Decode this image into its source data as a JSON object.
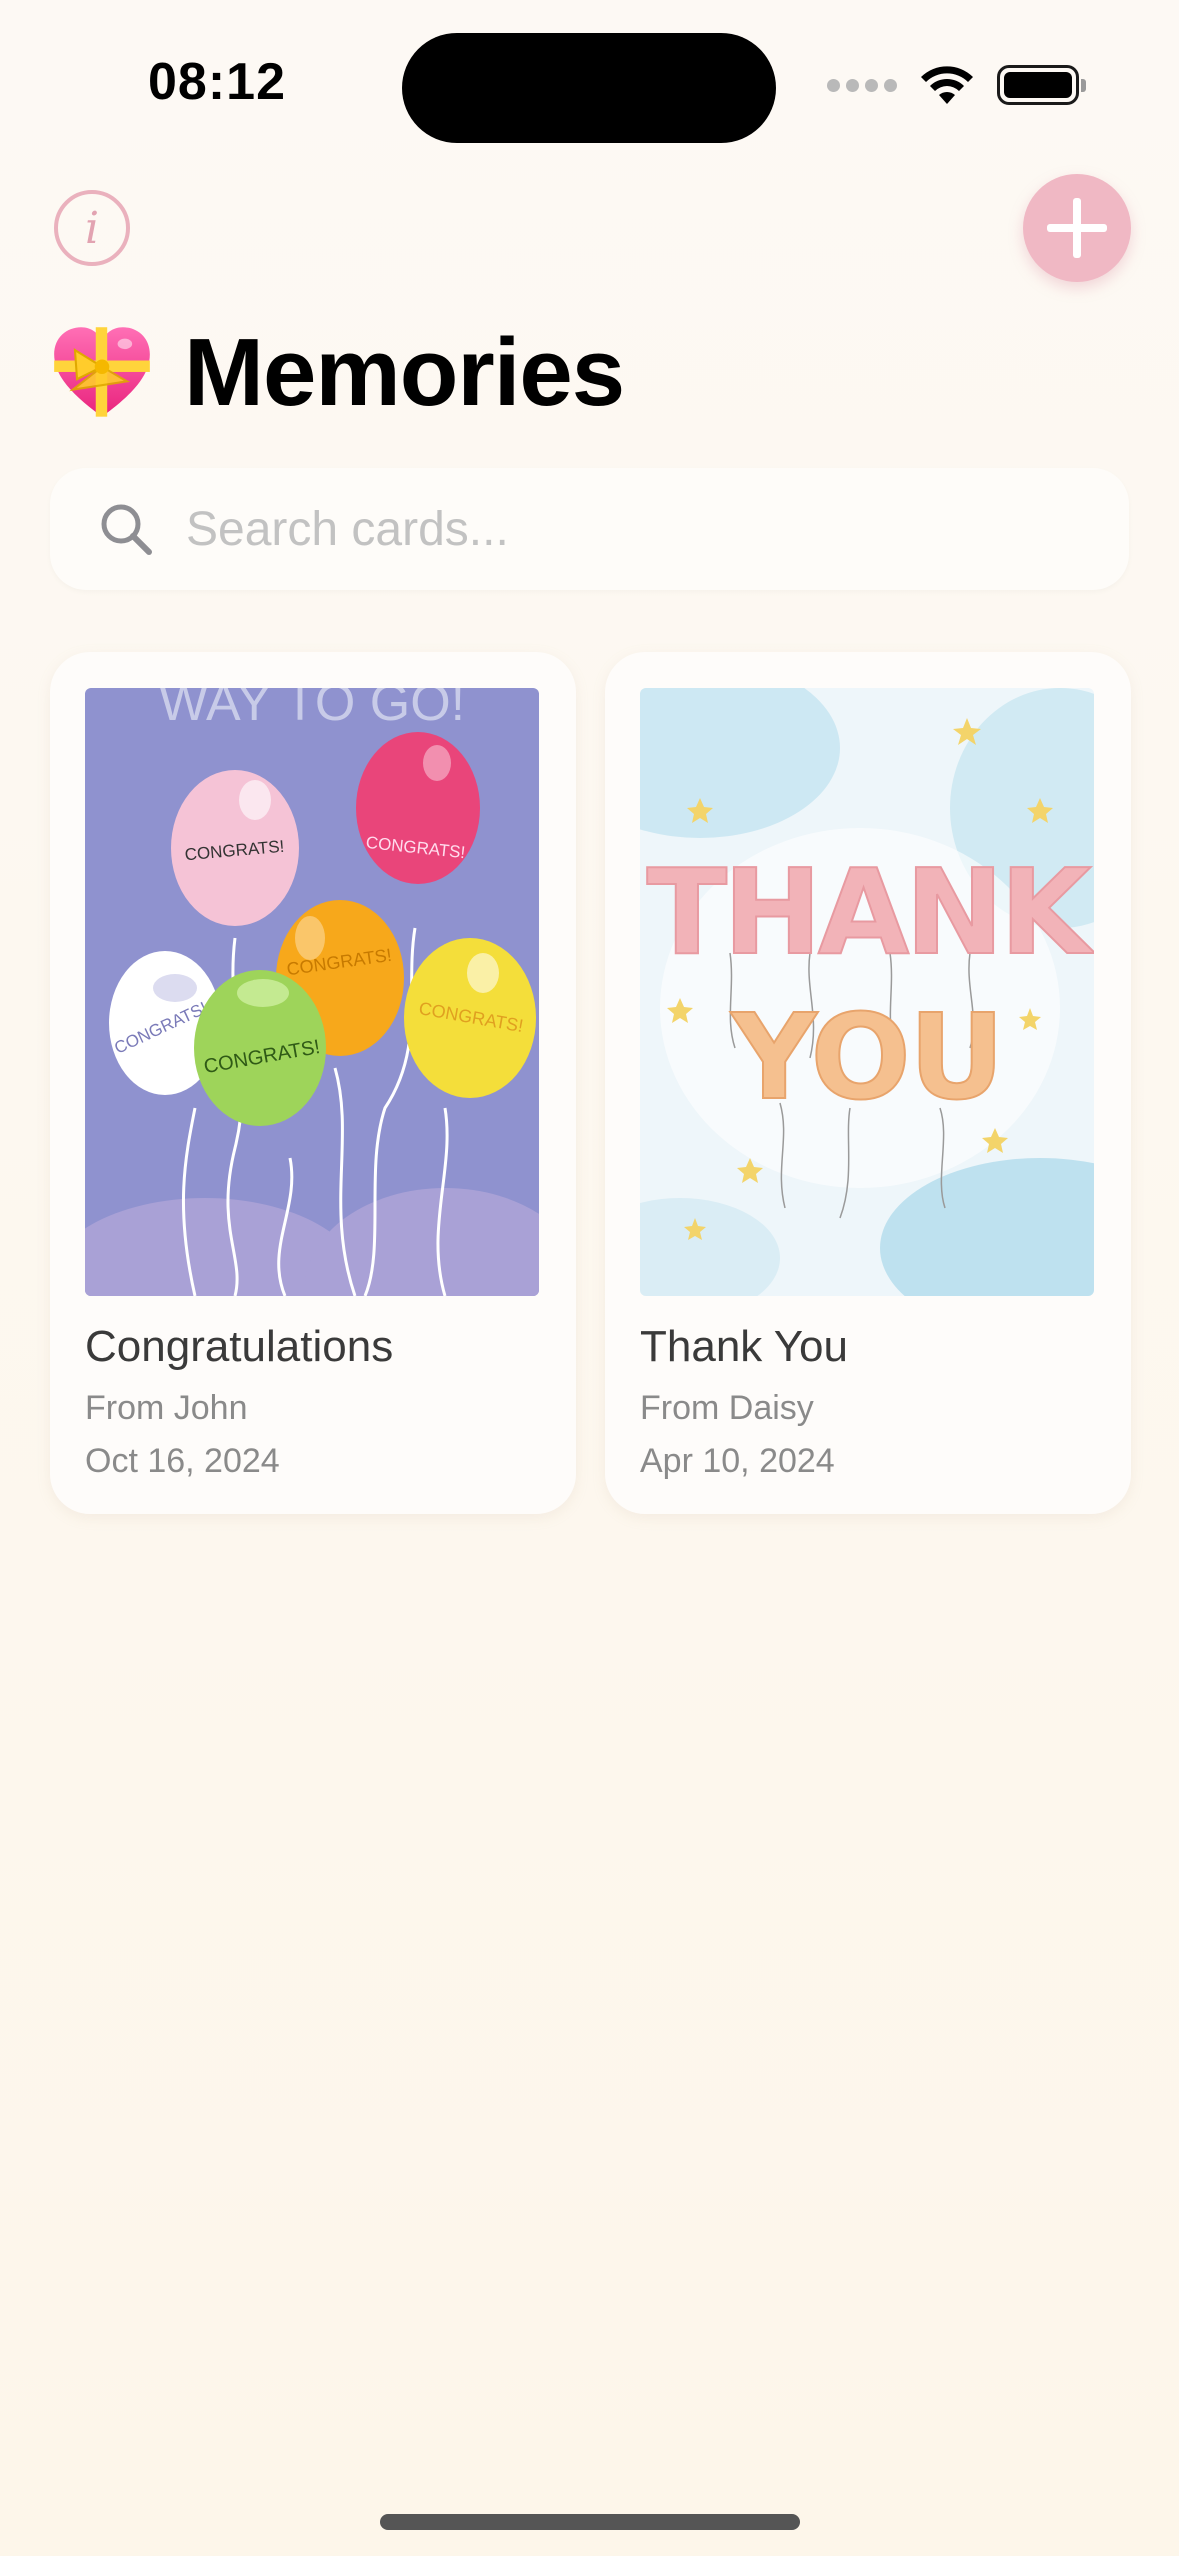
{
  "status_bar": {
    "time": "08:12"
  },
  "header": {
    "title": "Memories"
  },
  "search": {
    "placeholder": "Search cards..."
  },
  "cards": [
    {
      "title": "Congratulations",
      "from": "From John",
      "date": "Oct 16, 2024",
      "image_text": {
        "heading": "WAY TO GO!",
        "balloon_text": "CONGRATS!"
      }
    },
    {
      "title": "Thank You",
      "from": "From Daisy",
      "date": "Apr 10, 2024",
      "image_text": {
        "line1": "THANK",
        "line2": "YOU"
      }
    }
  ],
  "colors": {
    "accent_pink": "#f0b8c4",
    "background": "#fdf8f0",
    "card_background": "#fefcfa"
  },
  "icons": {
    "info": "info-circle-icon",
    "add": "plus-icon",
    "search": "magnifier-icon",
    "title_emoji": "heart-with-ribbon-emoji"
  }
}
